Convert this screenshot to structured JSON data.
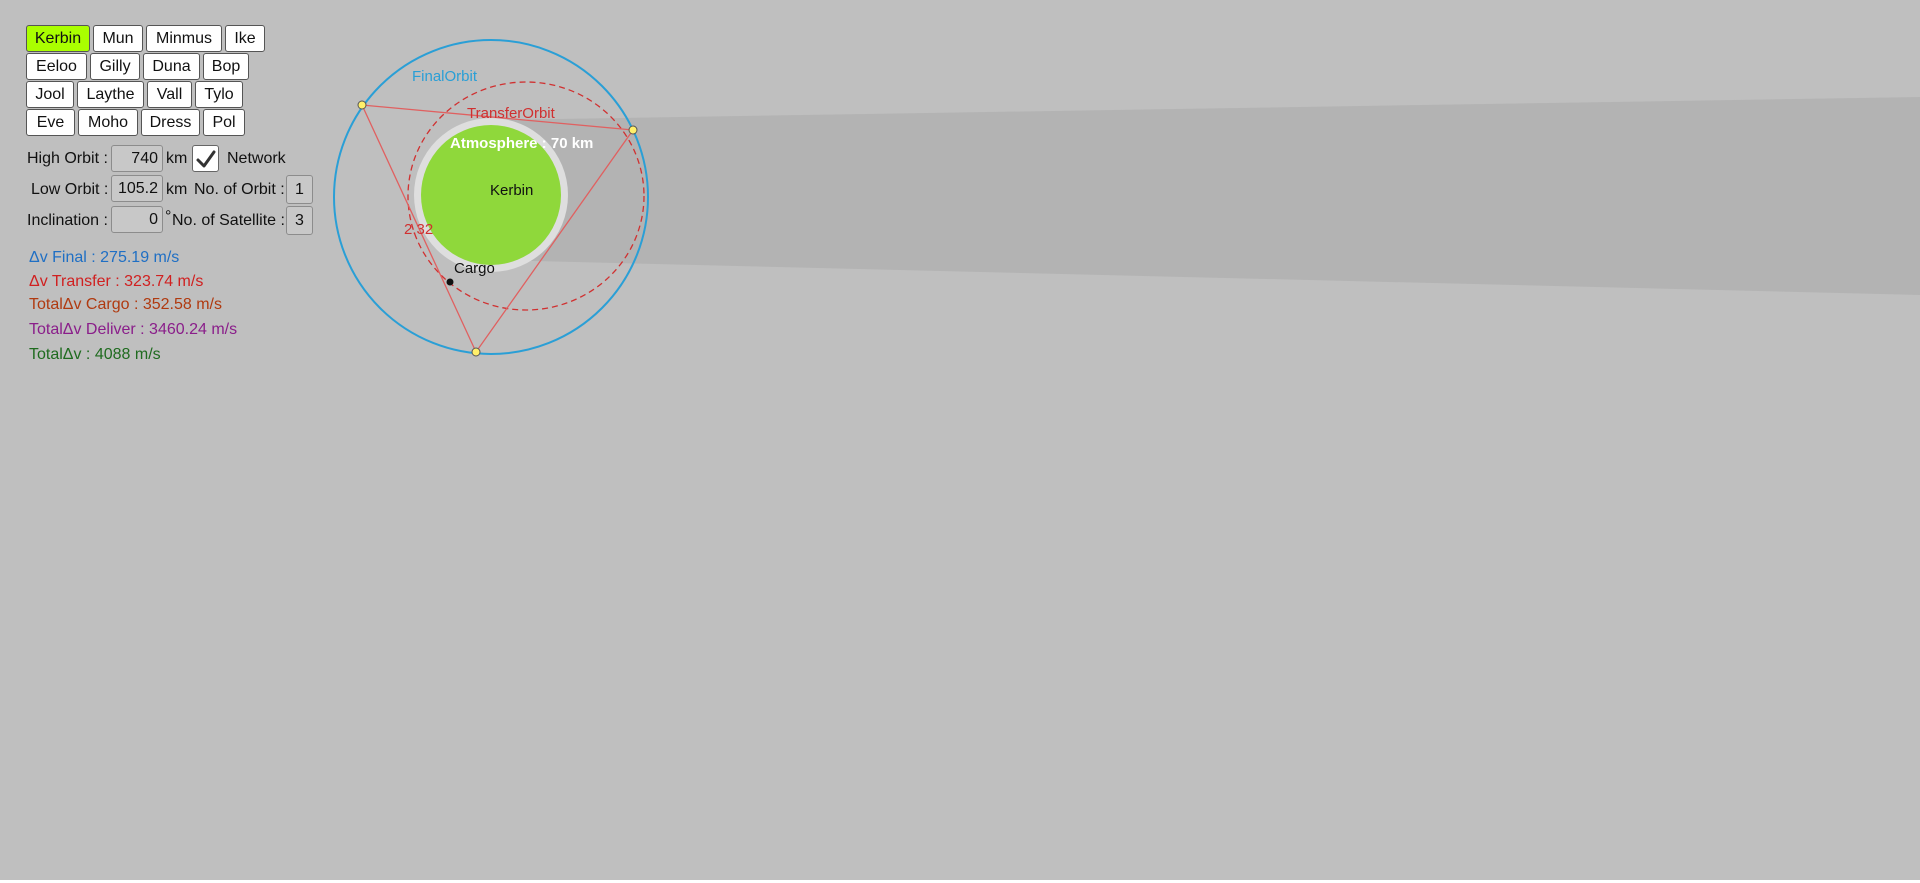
{
  "planet_buttons": {
    "rows": [
      [
        "Kerbin",
        "Mun",
        "Minmus",
        "Ike"
      ],
      [
        "Eeloo",
        "Gilly",
        "Duna",
        "Bop"
      ],
      [
        "Jool",
        "Laythe",
        "Vall",
        "Tylo"
      ],
      [
        "Eve",
        "Moho",
        "Dress",
        "Pol"
      ]
    ],
    "active": "Kerbin"
  },
  "settings": {
    "high_orbit": {
      "label": "High Orbit :",
      "value": "740",
      "unit": "km"
    },
    "low_orbit": {
      "label": "Low Orbit :",
      "value": "105.2",
      "unit": "km"
    },
    "inclination": {
      "label": "Inclination :",
      "value": "0",
      "unit": "°"
    },
    "network": {
      "label": "Network",
      "checked": true
    },
    "num_orbit": {
      "label": "No. of Orbit :",
      "value": "1"
    },
    "num_satellite": {
      "label": "No. of Satellite :",
      "value": "3"
    }
  },
  "results": {
    "dv_final": "Δv Final : 275.19 m/s",
    "dv_transfer": "Δv Transfer : 323.74 m/s",
    "total_dv_cargo": "TotalΔv Cargo : 352.58 m/s",
    "total_dv_deliver": "TotalΔv Deliver : 3460.24 m/s",
    "total_dv": "TotalΔv : 4088 m/s"
  },
  "diagram": {
    "final_orbit_label": "FinalOrbit",
    "transfer_orbit_label": "TransferOrbit",
    "atmosphere_label": "Atmosphere : 70 km",
    "planet_label": "Kerbin",
    "cargo_label": "Cargo",
    "angle_label": "2.32"
  },
  "colors": {
    "background": "#bfbfbf",
    "active_button": "#aaff00",
    "planet": "#8fd83b",
    "final_orbit": "#2a9fd6",
    "transfer_orbit": "#d03030",
    "dv_final": "#1f6fc4",
    "dv_transfer": "#d02020",
    "total_cargo": "#b03a10",
    "total_deliver": "#8a1e8a",
    "total_dv": "#1f6b1f"
  }
}
